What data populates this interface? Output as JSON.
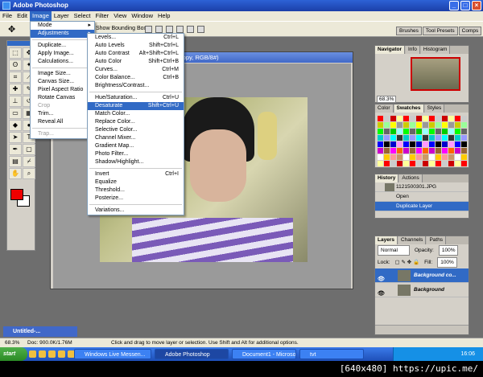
{
  "window": {
    "title": "Adobe Photoshop",
    "controls": [
      "_",
      "□",
      "×"
    ]
  },
  "menubar": [
    "File",
    "Edit",
    "Image",
    "Layer",
    "Select",
    "Filter",
    "View",
    "Window",
    "Help"
  ],
  "options": {
    "show_bounding_box": "Show Bounding Box"
  },
  "palette_well": [
    "Brushes",
    "Tool Presets",
    "Comps"
  ],
  "document": {
    "title": "copy, RGB/8#)"
  },
  "image_menu": [
    {
      "label": "Mode",
      "sub": true
    },
    {
      "label": "Adjustments",
      "sub": true,
      "active": true
    },
    {
      "sep": true
    },
    {
      "label": "Duplicate..."
    },
    {
      "label": "Apply Image..."
    },
    {
      "label": "Calculations..."
    },
    {
      "sep": true
    },
    {
      "label": "Image Size..."
    },
    {
      "label": "Canvas Size..."
    },
    {
      "label": "Pixel Aspect Ratio",
      "sub": true
    },
    {
      "label": "Rotate Canvas",
      "sub": true
    },
    {
      "label": "Crop",
      "disabled": true
    },
    {
      "label": "Trim..."
    },
    {
      "label": "Reveal All"
    },
    {
      "sep": true
    },
    {
      "label": "Trap...",
      "disabled": true
    }
  ],
  "adjust_menu": [
    {
      "label": "Levels...",
      "sc": "Ctrl+L"
    },
    {
      "label": "Auto Levels",
      "sc": "Shift+Ctrl+L"
    },
    {
      "label": "Auto Contrast",
      "sc": "Alt+Shift+Ctrl+L"
    },
    {
      "label": "Auto Color",
      "sc": "Shift+Ctrl+B"
    },
    {
      "label": "Curves...",
      "sc": "Ctrl+M"
    },
    {
      "label": "Color Balance...",
      "sc": "Ctrl+B"
    },
    {
      "label": "Brightness/Contrast..."
    },
    {
      "sep": true
    },
    {
      "label": "Hue/Saturation...",
      "sc": "Ctrl+U"
    },
    {
      "label": "Desaturate",
      "sc": "Shift+Ctrl+U",
      "active": true
    },
    {
      "label": "Match Color..."
    },
    {
      "label": "Replace Color..."
    },
    {
      "label": "Selective Color..."
    },
    {
      "label": "Channel Mixer..."
    },
    {
      "label": "Gradient Map..."
    },
    {
      "label": "Photo Filter..."
    },
    {
      "label": "Shadow/Highlight..."
    },
    {
      "sep": true
    },
    {
      "label": "Invert",
      "sc": "Ctrl+I"
    },
    {
      "label": "Equalize"
    },
    {
      "label": "Threshold..."
    },
    {
      "label": "Posterize..."
    },
    {
      "sep": true
    },
    {
      "label": "Variations..."
    }
  ],
  "navigator": {
    "tabs": [
      "Navigator",
      "Info",
      "Histogram"
    ],
    "zoom": "68.3%"
  },
  "swatches": {
    "tabs": [
      "Color",
      "Swatches",
      "Styles"
    ]
  },
  "history": {
    "tabs": [
      "History",
      "Actions"
    ],
    "items": [
      {
        "label": "1121500301.JPG",
        "thumb": true
      },
      {
        "label": "Open"
      },
      {
        "label": "Duplicate Layer",
        "active": true
      }
    ]
  },
  "layers": {
    "tabs": [
      "Layers",
      "Channels",
      "Paths"
    ],
    "mode": "Normal",
    "opacity_label": "Opacity:",
    "opacity": "100%",
    "lock_label": "Lock:",
    "fill_label": "Fill:",
    "fill": "100%",
    "items": [
      {
        "label": "Background co...",
        "active": true
      },
      {
        "label": "Background"
      }
    ]
  },
  "untitled": {
    "title": "Untitled-..."
  },
  "status": {
    "zoom": "68.3%",
    "doc": "Doc: 900.0K/1.76M",
    "message": "Click and drag to move layer or selection.  Use Shift and Alt for additional options."
  },
  "taskbar": {
    "start": "start",
    "items": [
      "Windows Live Messen...",
      "Adobe Photoshop",
      "Document1 - Microsof...",
      "tvt"
    ],
    "active": 1,
    "time": "16:06"
  },
  "watermark": "[640x480] https://upic.me/"
}
